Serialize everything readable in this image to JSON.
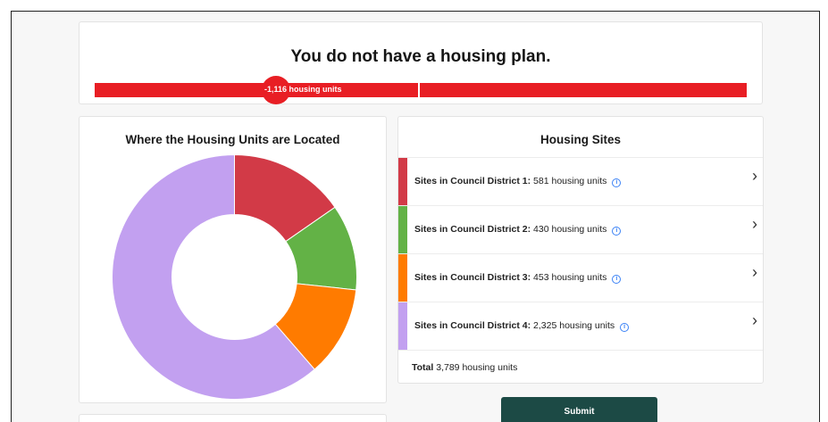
{
  "plan": {
    "title": "You do not have a housing plan.",
    "bar_label": "-1,116 housing units",
    "bar_color": "#e81e24"
  },
  "location_chart": {
    "title": "Where the Housing Units are Located"
  },
  "sites": {
    "title": "Housing Sites",
    "unit_suffix": "housing units",
    "rows": [
      {
        "label": "Sites in Council District 1:",
        "count": "581",
        "color": "#d23a47"
      },
      {
        "label": "Sites in Council District 2:",
        "count": "430",
        "color": "#63b246"
      },
      {
        "label": "Sites in Council District 3:",
        "count": "453",
        "color": "#ff7b00"
      },
      {
        "label": "Sites in Council District 4:",
        "count": "2,325",
        "color": "#c2a0f0"
      }
    ],
    "total_label": "Total",
    "total_count": "3,789"
  },
  "chart_data": {
    "type": "pie",
    "donut": true,
    "categories": [
      "Council District 1",
      "Council District 2",
      "Council District 3",
      "Council District 4"
    ],
    "values": [
      581,
      430,
      453,
      2325
    ],
    "colors": [
      "#d23a47",
      "#63b246",
      "#ff7b00",
      "#c2a0f0"
    ],
    "start_angle_deg": 0,
    "title": "Where the Housing Units are Located"
  },
  "actions": {
    "submit_label": "Submit"
  }
}
